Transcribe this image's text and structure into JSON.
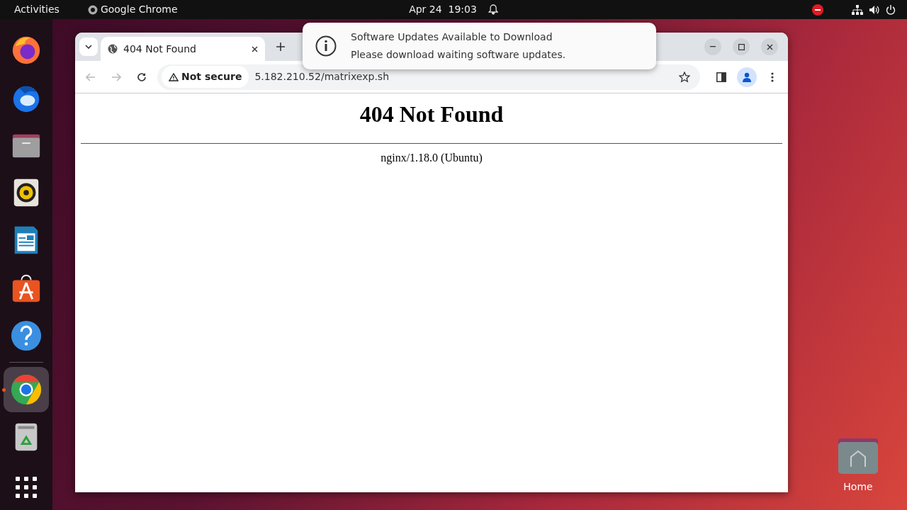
{
  "top_bar": {
    "activities": "Activities",
    "app_name": "Google Chrome",
    "date": "Apr 24",
    "time": "19:03"
  },
  "dock": {
    "items": [
      {
        "selected": false,
        "running": false
      },
      {
        "selected": false,
        "running": false
      },
      {
        "selected": false,
        "running": false
      },
      {
        "selected": false,
        "running": false
      },
      {
        "selected": false,
        "running": false
      },
      {
        "selected": false,
        "running": false
      },
      {
        "selected": false,
        "running": false
      },
      {
        "selected": true,
        "running": true
      },
      {
        "selected": false,
        "running": false
      }
    ]
  },
  "browser": {
    "tabs": [
      {
        "title": "404 Not Found",
        "selected": true
      }
    ],
    "address_bar": {
      "security": "Not secure",
      "url": "5.182.210.52/matrixexp.sh"
    },
    "page": {
      "heading": "404 Not Found",
      "footer": "nginx/1.18.0 (Ubuntu)"
    }
  },
  "notification": {
    "title": "Software Updates Available to Download",
    "body": "Please download waiting software updates."
  },
  "desktop_icons": [
    {
      "label": "Home"
    }
  ]
}
